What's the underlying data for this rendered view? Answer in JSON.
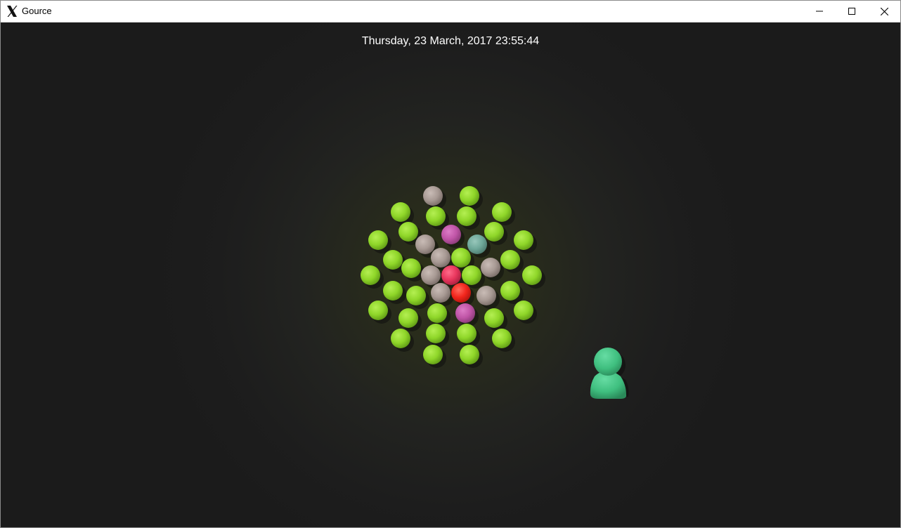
{
  "window": {
    "title": "Gource",
    "app_icon": "x-logo-icon",
    "controls": {
      "minimize": "minimize-icon",
      "maximize": "maximize-icon",
      "close": "close-icon"
    }
  },
  "visualization": {
    "datetime": "Thursday, 23 March, 2017 23:55:44",
    "colors": {
      "background": "#1b1b1b",
      "file_green": "#8fd629",
      "file_gray": "#a89a94",
      "file_magenta": "#c055a7",
      "file_teal": "#6fa89a",
      "file_pink_red": "#e8365d",
      "file_red": "#f2261d",
      "user_avatar": "#3fbf7f"
    }
  }
}
